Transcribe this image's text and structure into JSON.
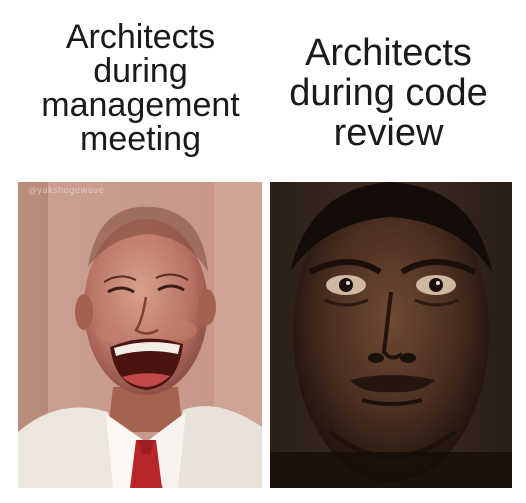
{
  "meme": {
    "left": {
      "caption": "Architects\nduring\nmanagement\nmeeting",
      "watermark": "@yakshogewave"
    },
    "right": {
      "caption": "Architects\nduring code\nreview"
    }
  },
  "colors": {
    "background": "#ffffff",
    "text": "#1a1a1a",
    "left_warm_tone": "#b8776a",
    "right_dark_tone": "#3a2a20"
  }
}
